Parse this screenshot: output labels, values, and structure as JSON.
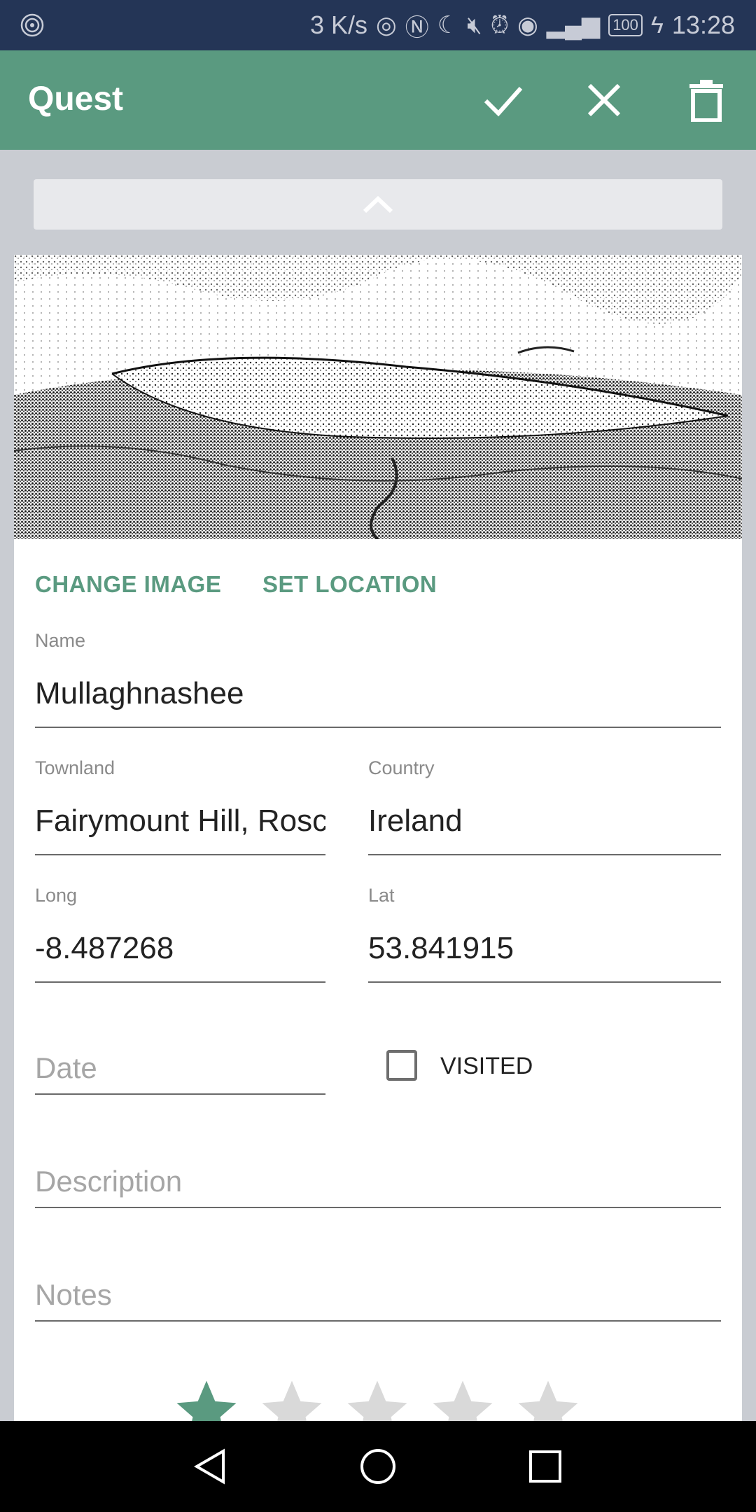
{
  "status_bar": {
    "network_speed": "3 K/s",
    "icons": [
      "hotspot-icon",
      "nfc-icon",
      "moon-icon",
      "mute-icon",
      "alarm-icon",
      "eye-icon",
      "signal-icon"
    ],
    "battery": "100",
    "time": "13:28"
  },
  "toolbar": {
    "title": "Quest",
    "actions": [
      "check-icon",
      "close-icon",
      "delete-icon"
    ]
  },
  "card": {
    "image_description_icon": "landscape-sketch",
    "change_image_label": "CHANGE IMAGE",
    "set_location_label": "SET LOCATION",
    "name_label": "Name",
    "name_value": "Mullaghnashee",
    "townland_label": "Townland",
    "townland_value": "Fairymount Hill, Roscommon",
    "country_label": "Country",
    "country_value": "Ireland",
    "long_label": "Long",
    "long_value": "-8.487268",
    "lat_label": "Lat",
    "lat_value": "53.841915",
    "date_placeholder": "Date",
    "visited_label": "VISITED",
    "visited_checked": false,
    "description_placeholder": "Description",
    "notes_placeholder": "Notes",
    "rating": 1,
    "rating_max": 5
  },
  "colors": {
    "accent": "#5a9a80",
    "status_bar": "#243556",
    "star_empty": "#d9d9d9"
  },
  "nav_bar": {
    "buttons": [
      "back-icon",
      "home-icon",
      "recents-icon"
    ]
  }
}
